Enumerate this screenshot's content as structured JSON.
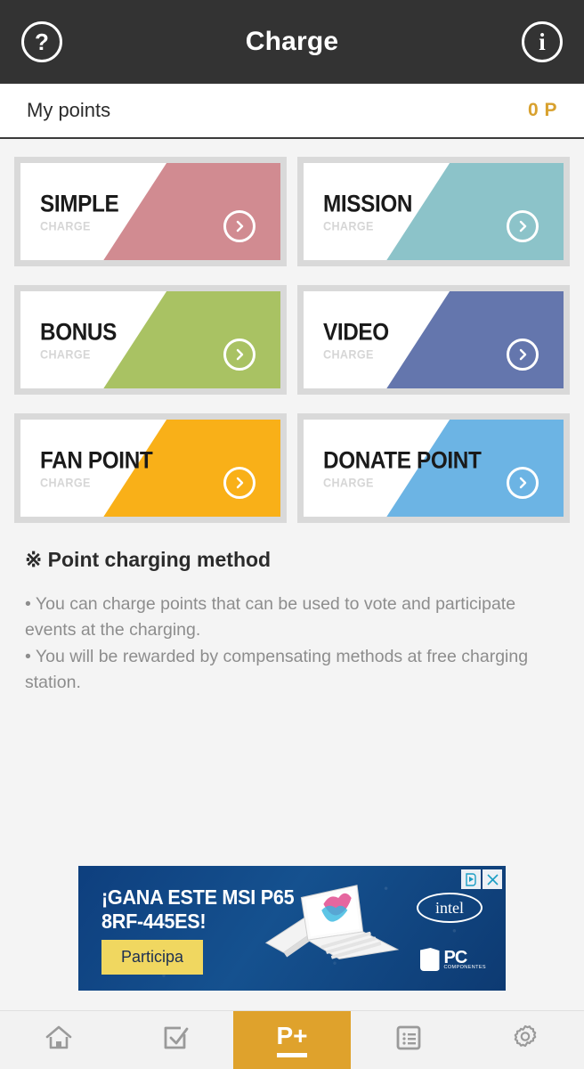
{
  "header": {
    "title": "Charge",
    "help_icon": "question-circle-icon",
    "help_glyph": "?",
    "info_icon": "info-circle-icon",
    "info_glyph": "i",
    "background": "#333333"
  },
  "points": {
    "label": "My points",
    "value": "0 P",
    "value_color": "#d8a12e"
  },
  "cards": [
    {
      "title": "SIMPLE",
      "subtitle": "CHARGE",
      "color": "#d18b91",
      "arrow_icon": "chevron-right-icon",
      "name": "simple-charge-card"
    },
    {
      "title": "MISSION",
      "subtitle": "CHARGE",
      "color": "#8cc3c9",
      "arrow_icon": "chevron-right-icon",
      "name": "mission-charge-card"
    },
    {
      "title": "BONUS",
      "subtitle": "CHARGE",
      "color": "#a9c263",
      "arrow_icon": "chevron-right-icon",
      "name": "bonus-charge-card"
    },
    {
      "title": "VIDEO",
      "subtitle": "CHARGE",
      "color": "#6476ad",
      "arrow_icon": "chevron-right-icon",
      "name": "video-charge-card"
    },
    {
      "title": "FAN POINT",
      "subtitle": "CHARGE",
      "color": "#f9b018",
      "arrow_icon": "chevron-right-icon",
      "name": "fan-point-charge-card"
    },
    {
      "title": "DONATE POINT",
      "subtitle": "CHARGE",
      "color": "#6cb4e4",
      "arrow_icon": "chevron-right-icon",
      "name": "donate-point-charge-card"
    }
  ],
  "info": {
    "title": "※ Point charging method",
    "line1": "• You can charge points that can be used to vote and participate events at the charging.",
    "line2": "• You will be rewarded by compensating methods at free charging station."
  },
  "ad": {
    "headline_line1": "¡GANA ESTE MSI P65",
    "headline_line2": "8RF-445ES!",
    "cta_label": "Participa",
    "brand_intel": "intel",
    "brand_pc": "PC",
    "brand_pc_sub": "COMPONENTES",
    "adchoices_icon": "adchoices-icon",
    "close_icon": "close-icon",
    "close_glyph": "✕",
    "background": "#0e3f7e"
  },
  "nav": {
    "items": [
      {
        "name": "nav-home",
        "icon": "home-icon",
        "label": "",
        "active": false
      },
      {
        "name": "nav-vote",
        "icon": "checkbox-vote-icon",
        "label": "",
        "active": false
      },
      {
        "name": "nav-charge",
        "icon": "point-plus-icon",
        "label": "P+",
        "active": true
      },
      {
        "name": "nav-list",
        "icon": "list-document-icon",
        "label": "",
        "active": false
      },
      {
        "name": "nav-settings",
        "icon": "gear-icon",
        "label": "",
        "active": false
      }
    ],
    "active_color": "#dfa22c",
    "icon_color": "#9a9a9a"
  }
}
